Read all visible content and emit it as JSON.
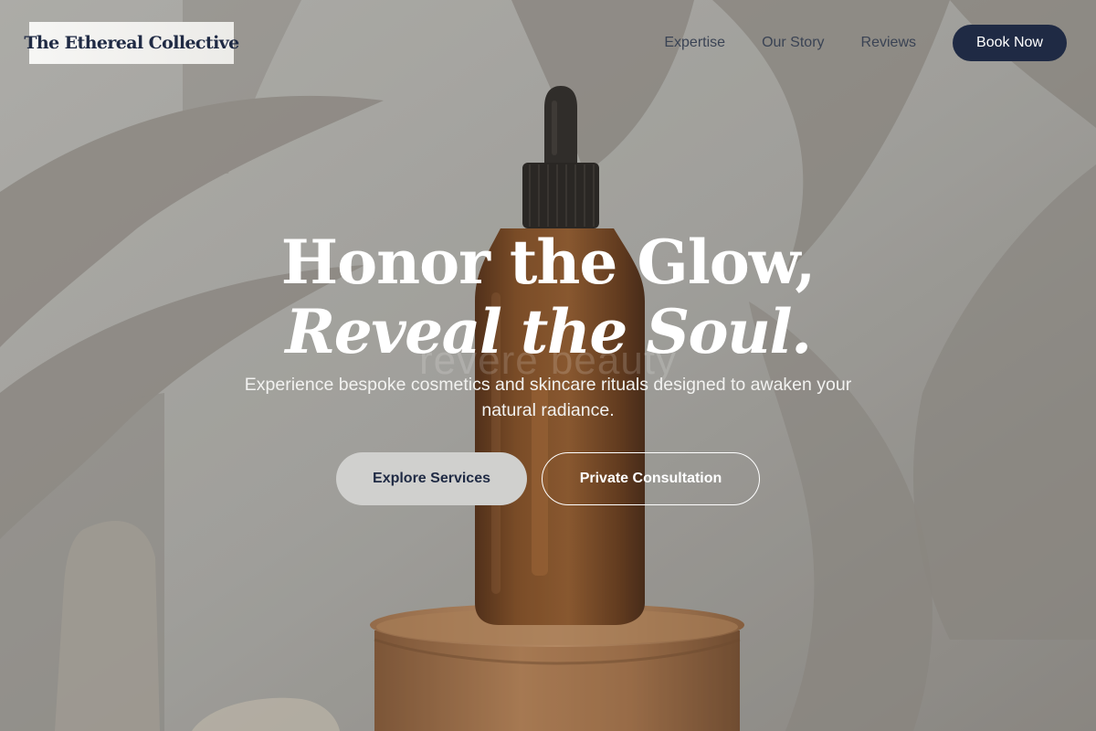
{
  "brand": {
    "name": "The Ethereal Collective"
  },
  "nav": {
    "links": [
      "Expertise",
      "Our Story",
      "Reviews"
    ],
    "cta": "Book Now"
  },
  "hero": {
    "headline_line1": "Honor the Glow,",
    "headline_line2": "Reveal the Soul.",
    "watermark": "revere beauty",
    "subtitle": "Experience bespoke cosmetics and skincare rituals designed to awaken your natural radiance.",
    "primary_cta": "Explore Services",
    "secondary_cta": "Private Consultation",
    "background_image": "amber-dropper-bottle-on-wooden-pedestal"
  },
  "colors": {
    "brand_navy": "#1f2a44",
    "headline": "#ffffff",
    "amber": "#7a4216"
  },
  "icons": [
    "dropper-bottle-image"
  ]
}
